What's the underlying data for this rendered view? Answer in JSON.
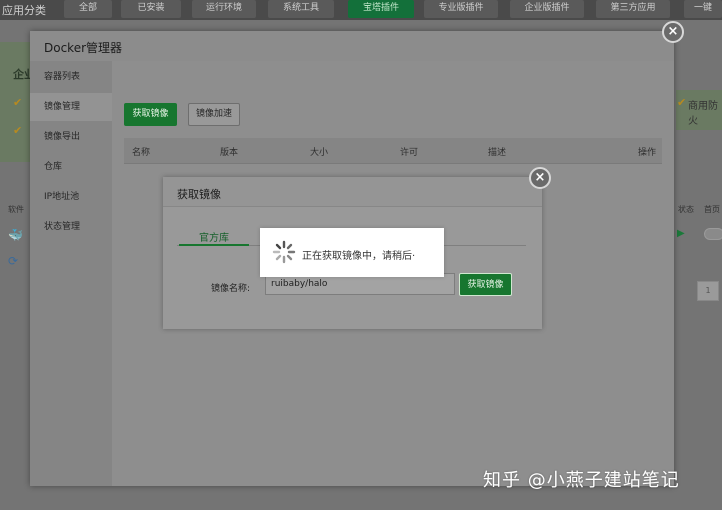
{
  "background": {
    "category_label": "应用分类",
    "tabs": [
      {
        "label": "全部",
        "active": false
      },
      {
        "label": "已安装",
        "active": false
      },
      {
        "label": "运行环境",
        "active": false
      },
      {
        "label": "系统工具",
        "active": false
      },
      {
        "label": "宝塔插件",
        "active": true
      },
      {
        "label": "专业版插件",
        "active": false
      },
      {
        "label": "企业版插件",
        "active": false
      },
      {
        "label": "第三方应用",
        "active": false
      },
      {
        "label": "一键",
        "active": false
      }
    ],
    "enterprise_label": "企业",
    "right_labels": {
      "commercial": "商用防火",
      "status": "状态",
      "home": "首页",
      "page": "1"
    },
    "software_label": "软件"
  },
  "docker_modal": {
    "title": "Docker管理器",
    "sidebar": [
      {
        "label": "容器列表",
        "active": false
      },
      {
        "label": "镜像管理",
        "active": true
      },
      {
        "label": "镜像导出",
        "active": false
      },
      {
        "label": "仓库",
        "active": false
      },
      {
        "label": "IP地址池",
        "active": false
      },
      {
        "label": "状态管理",
        "active": false
      }
    ],
    "buttons": {
      "pull": "获取镜像",
      "accelerate": "镜像加速"
    },
    "table_headers": {
      "name": "名称",
      "version": "版本",
      "size": "大小",
      "license": "许可",
      "description": "描述",
      "action": "操作"
    },
    "close_symbol": "×"
  },
  "pull_modal": {
    "title": "获取镜像",
    "tab": "官方库",
    "field_label": "镜像名称:",
    "field_value": "ruibaby/halo",
    "submit": "获取镜像",
    "close_symbol": "×"
  },
  "loading": {
    "message": "正在获取镜像中，请稍后·"
  },
  "watermark": "知乎 @小燕子建站笔记",
  "colors": {
    "accent_green": "#17762f",
    "overlay": "#6e6e6e"
  }
}
